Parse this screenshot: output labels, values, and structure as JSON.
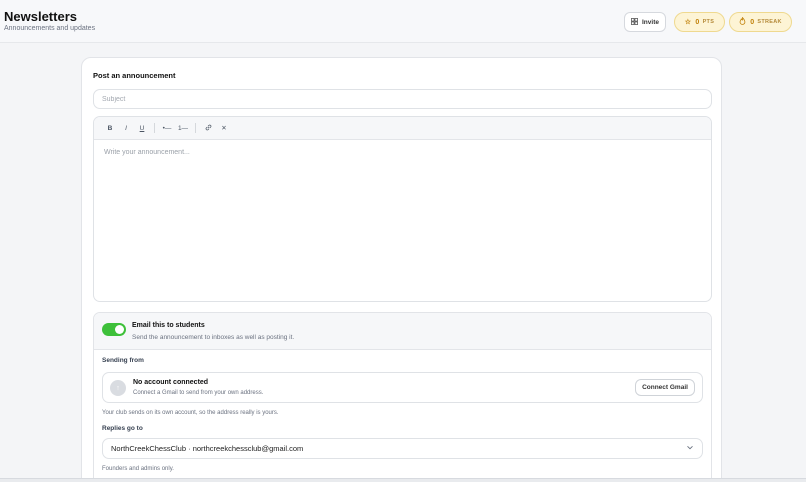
{
  "header": {
    "title": "Newsletters",
    "subtitle": "Announcements and updates",
    "invite_label": "Invite",
    "points": {
      "value": "0",
      "unit": "PTS"
    },
    "streak": {
      "value": "0",
      "unit": "STREAK"
    }
  },
  "composer": {
    "title": "Post an announcement",
    "subject_placeholder": "Subject",
    "subject_value": "",
    "body_placeholder": "Write your announcement...",
    "toolbar": {
      "bold": "B",
      "italic": "I",
      "underline": "U",
      "bullet_list": "•—",
      "numbered_list": "1—",
      "link": "🔗",
      "clear": "✕"
    }
  },
  "email": {
    "enabled": true,
    "title": "Email this to students",
    "description": "Send the announcement to inboxes as well as posting it.",
    "sending_from_label": "Sending from",
    "account": {
      "avatar_glyph": "↑",
      "title": "No account connected",
      "description": "Connect a Gmail to send from your own address.",
      "button_label": "Connect Gmail"
    },
    "sending_from_helper": "Your club sends on its own account, so the address really is yours.",
    "replies_label": "Replies go to",
    "replies_value": "NorthCreekChessClub · northcreekchessclub@gmail.com",
    "replies_helper": "Founders and admins only."
  },
  "colors": {
    "toggle_on": "#3ec03a",
    "badge_bg": "#fdf4d5",
    "badge_text": "#c07f06"
  }
}
